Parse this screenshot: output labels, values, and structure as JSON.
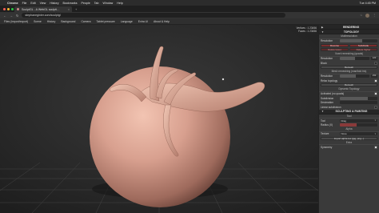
{
  "menubar": {
    "apple": "",
    "app": "Chrome",
    "items": [
      "File",
      "Edit",
      "View",
      "History",
      "Bookmarks",
      "People",
      "Tab",
      "Window",
      "Help"
    ],
    "right": [
      "",
      "",
      "Tue 4:45 PM"
    ]
  },
  "browser": {
    "tab_title": "SculptGL - A WebGL sculpti…",
    "tab_close": "×",
    "new_tab": "+",
    "url": "stephaneginier.com/sculptgl",
    "back": "←",
    "forward": "→",
    "reload": "↻",
    "star": "☆",
    "menu": "⋮"
  },
  "app_menu": [
    "Files (import/export)",
    "Scene",
    "History",
    "Background",
    "Camera",
    "Tablet pressure",
    "Language",
    "Extra UI",
    "About & Help"
  ],
  "viewport": {
    "stats": [
      "Vertices : 1 23456",
      "Faces : 1 23456"
    ]
  },
  "panel": {
    "rendering": "RENDERING",
    "topology": "TOPOLOGY",
    "multiresolution": "Multiresolution",
    "resolution_label": "Resolution",
    "resolution_value": 0.6,
    "reverse_btn": "Reverse",
    "subdivide_btn": "Subdivide",
    "delete_lower_btn": "Delete lower",
    "delete_higher_btn": "Delete higher",
    "voxel_remeshing": "Voxel remeshing (quads)",
    "voxel_resolution_label": "Resolution",
    "voxel_resolution_value": "120",
    "voxel_resolution_level": 0.5,
    "block_label": "Block",
    "remesh_btn": "Remesh",
    "manifold_title": "Mesh remeshing (manifold tris)",
    "manifold_resolution_label": "Resolution",
    "manifold_resolution_value": "150",
    "manifold_resolution_level": 0.55,
    "relax_label": "Relax topology",
    "manifold_remesh_btn": "Remesh",
    "dynamic_topology": "Dynamic Topology",
    "activated_label": "Activated (no quads)",
    "subdivision_label": "Subdivision",
    "subdivision_value": 0.75,
    "decimation_label": "Decimation",
    "decimation_value": 0.0,
    "linear_label": "Linear subdivision",
    "sculpting": "SCULPTING & PAINTING",
    "tool_title": "Tool",
    "tool_label": "Tool",
    "tool_value": "Drag",
    "radius_label": "Radius (X)",
    "radius_value": 0.45,
    "alpha_title": "Alpha",
    "texture_label": "Texture",
    "texture_value": "None",
    "import_alpha_btn": "Import alpha tex (jpg, png...)",
    "extra_label": "Extra",
    "symmetry_label": "Symmetry"
  },
  "colors": {
    "accent_red": "#8a3a3a",
    "sculpt_skin": "#d8a08f"
  }
}
